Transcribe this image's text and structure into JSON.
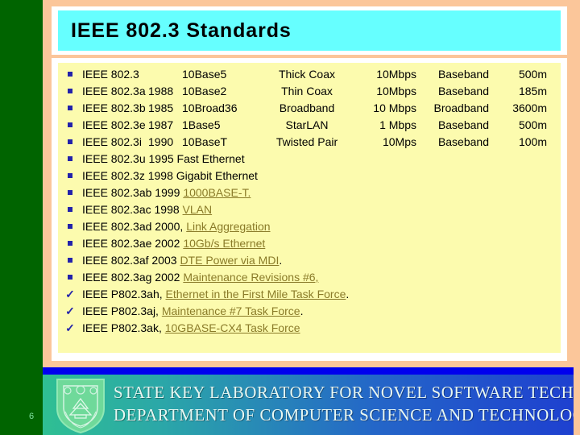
{
  "slide": {
    "page_number": "6",
    "title": "IEEE 802.3 Standards",
    "colors": {
      "background": "#FBC69A",
      "left_bar": "#006400",
      "title_box": "#66FFFF",
      "content_box": "#FCFBAE",
      "bullet": "#2222AA",
      "link": "#8A7B29",
      "footer_bar": "#0000EE"
    }
  },
  "table_rows": [
    {
      "marker": "square-bullet",
      "standard": "IEEE 802.3",
      "year": "",
      "name": "10Base5",
      "media": "Thick Coax",
      "rate": "10Mbps",
      "signaling": "Baseband",
      "distance": "500m"
    },
    {
      "marker": "square-bullet",
      "standard": "IEEE 802.3a",
      "year": "1988",
      "name": "10Base2",
      "media": "Thin Coax",
      "rate": "10Mbps",
      "signaling": "Baseband",
      "distance": "185m"
    },
    {
      "marker": "square-bullet",
      "standard": "IEEE 802.3b",
      "year": "1985",
      "name": "10Broad36",
      "media": "Broadband",
      "rate": "10 Mbps",
      "signaling": "Broadband",
      "distance": "3600m"
    },
    {
      "marker": "square-bullet",
      "standard": "IEEE 802.3e",
      "year": "1987",
      "name": "1Base5",
      "media": "StarLAN",
      "rate": "1 Mbps",
      "signaling": "Baseband",
      "distance": "500m"
    },
    {
      "marker": "square-bullet",
      "standard": "IEEE 802.3i",
      "year": "1990",
      "name": "10BaseT",
      "media": "Twisted Pair",
      "rate": "10Mps",
      "signaling": "Baseband",
      "distance": "100m"
    }
  ],
  "simple_rows": [
    {
      "marker": "square-bullet",
      "prefix": "IEEE 802.3u  1995  Fast Ethernet",
      "link": "",
      "suffix": ""
    },
    {
      "marker": "square-bullet",
      "prefix": "IEEE 802.3z   1998 Gigabit Ethernet",
      "link": "",
      "suffix": ""
    },
    {
      "marker": "square-bullet",
      "prefix": "IEEE 802.3ab 1999 ",
      "link": "1000BASE-T.",
      "suffix": ""
    },
    {
      "marker": "square-bullet",
      "prefix": "IEEE 802.3ac 1998  ",
      "link": "VLAN",
      "suffix": ""
    },
    {
      "marker": "square-bullet",
      "prefix": "IEEE 802.3ad 2000, ",
      "link": "Link Aggregation",
      "suffix": ""
    },
    {
      "marker": "square-bullet",
      "prefix": "IEEE 802.3ae 2002  ",
      "link": "10Gb/s Ethernet",
      "suffix": ""
    },
    {
      "marker": "square-bullet",
      "prefix": "IEEE 802.3af  2003  ",
      "link": "DTE Power via MDI",
      "suffix": "."
    },
    {
      "marker": "square-bullet",
      "prefix": "IEEE 802.3ag 2002  ",
      "link": "Maintenance Revisions #6,",
      "suffix": ""
    },
    {
      "marker": "check-bullet",
      "prefix": "IEEE P802.3ah, ",
      "link": "Ethernet in the First Mile Task Force",
      "suffix": "."
    },
    {
      "marker": "check-bullet",
      "prefix": "IEEE P802.3aj, ",
      "link": "Maintenance #7 Task Force",
      "suffix": "."
    },
    {
      "marker": "check-bullet",
      "prefix": "IEEE P802.3ak, ",
      "link": "10GBASE-CX4 Task Force",
      "suffix": ""
    }
  ],
  "footer": {
    "line1": "STATE KEY LABORATORY FOR NOVEL SOFTWARE TECHNOLOGY",
    "line2": "DEPARTMENT OF COMPUTER SCIENCE AND TECHNOLOGY"
  }
}
